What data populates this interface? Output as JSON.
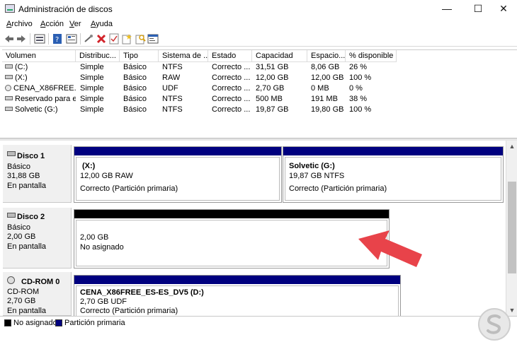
{
  "window": {
    "title": "Administración de discos",
    "controls": {
      "minimize": "—",
      "maximize": "☐",
      "close": "✕"
    }
  },
  "menu": [
    {
      "underline": "A",
      "rest": "rchivo"
    },
    {
      "underline": "A",
      "rest": "cción"
    },
    {
      "underline": "V",
      "rest": "er"
    },
    {
      "underline": "A",
      "rest": "yuda"
    }
  ],
  "toolbar_icons": [
    "back-arrow-icon",
    "forward-arrow-icon",
    "disk-view-icon",
    "help-icon",
    "properties-icon",
    "connect-icon",
    "delete-icon",
    "checklist-icon",
    "new-icon",
    "search-icon",
    "console-icon"
  ],
  "table": {
    "headers": [
      "Volumen",
      "Distribuc...",
      "Tipo",
      "Sistema de ...",
      "Estado",
      "Capacidad",
      "Espacio...",
      "% disponible"
    ],
    "rows": [
      [
        "(C:)",
        "Simple",
        "Básico",
        "NTFS",
        "Correcto ...",
        "31,51 GB",
        "8,06 GB",
        "26 %"
      ],
      [
        "(X:)",
        "Simple",
        "Básico",
        "RAW",
        "Correcto ...",
        "12,00 GB",
        "12,00 GB",
        "100 %"
      ],
      [
        "CENA_X86FREE...",
        "Simple",
        "Básico",
        "UDF",
        "Correcto ...",
        "2,70 GB",
        "0 MB",
        "0 %"
      ],
      [
        "Reservado para el...",
        "Simple",
        "Básico",
        "NTFS",
        "Correcto ...",
        "500 MB",
        "191 MB",
        "38 %"
      ],
      [
        "Solvetic (G:)",
        "Simple",
        "Básico",
        "NTFS",
        "Correcto ...",
        "19,87 GB",
        "19,80 GB",
        "100 %"
      ]
    ]
  },
  "disks": {
    "disk1": {
      "name": "Disco 1",
      "type": "Básico",
      "size": "31,88 GB",
      "status": "En pantalla",
      "partitions": [
        {
          "name": "(X:)",
          "detail": "12,00 GB RAW",
          "status": "Correcto (Partición primaria)"
        },
        {
          "name": "Solvetic  (G:)",
          "detail": "19,87 GB NTFS",
          "status": "Correcto (Partición primaria)"
        }
      ]
    },
    "disk2": {
      "name": "Disco 2",
      "type": "Básico",
      "size": "2,00 GB",
      "status": "En pantalla",
      "partitions": [
        {
          "size": "2,00 GB",
          "status": "No asignado"
        }
      ]
    },
    "cdrom0": {
      "name": "CD-ROM 0",
      "type": "CD-ROM",
      "size": "2,70 GB",
      "status": "En pantalla",
      "partitions": [
        {
          "name": "CENA_X86FREE_ES-ES_DV5  (D:)",
          "detail": "2,70 GB UDF",
          "status": "Correcto (Partición primaria)"
        }
      ]
    }
  },
  "legend": {
    "unallocated": "No asignado",
    "primary": "Partición primaria"
  },
  "colors": {
    "primary_partition": "#00007f",
    "unallocated": "#000000",
    "arrow": "#e8434a"
  }
}
